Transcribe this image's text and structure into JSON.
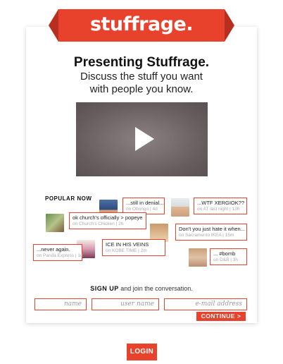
{
  "brand": {
    "logo": "stuffrage.",
    "accent": "#e8412c"
  },
  "hero": {
    "headline": "Presenting Stuffrage.",
    "subline_1": "Discuss the stuff you want",
    "subline_2": "with people you know."
  },
  "video": {
    "icon": "play-icon"
  },
  "popular": {
    "title": "POPULAR NOW",
    "posts": [
      {
        "text": "...still in denial....",
        "meta": "on Obongo | 4d"
      },
      {
        "text": "...WTF XERGIOK??",
        "meta": "on AT last night | 13h"
      },
      {
        "text": "ok church's officially > popeye",
        "meta": "on Church's Chicken | 2h"
      },
      {
        "text": "Don't you just hate it when...",
        "meta": "on Sacramento IKEA | 15m"
      },
      {
        "text": "ICE IN HIS VEINS",
        "meta": "on KOBE TIME | 2m"
      },
      {
        "text": "...never again.",
        "meta": "on Panda Express | 1d"
      },
      {
        "text": "... #bomb",
        "meta": "on D&B | 3h"
      }
    ]
  },
  "signup": {
    "lead": "SIGN UP",
    "rest": "and join the conversation.",
    "name_placeholder": "name",
    "username_placeholder": "user name",
    "email_placeholder": "e-mail address",
    "continue_label": "CONTINUE >"
  },
  "login_label": "LOGIN"
}
